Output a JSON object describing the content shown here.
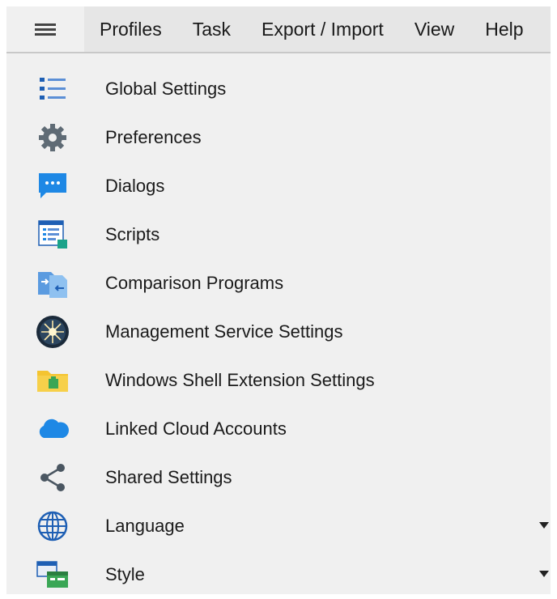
{
  "menubar": {
    "items": [
      "Profiles",
      "Task",
      "Export / Import",
      "View",
      "Help"
    ]
  },
  "list": {
    "items": [
      {
        "label": "Global Settings",
        "icon": "list-icon",
        "submenu": false
      },
      {
        "label": "Preferences",
        "icon": "gear-icon",
        "submenu": false
      },
      {
        "label": "Dialogs",
        "icon": "chat-bubble-icon",
        "submenu": false
      },
      {
        "label": "Scripts",
        "icon": "script-icon",
        "submenu": false
      },
      {
        "label": "Comparison Programs",
        "icon": "compare-files-icon",
        "submenu": false
      },
      {
        "label": "Management Service Settings",
        "icon": "network-globe-icon",
        "submenu": false
      },
      {
        "label": "Windows Shell Extension Settings",
        "icon": "folder-extension-icon",
        "submenu": false
      },
      {
        "label": "Linked Cloud Accounts",
        "icon": "cloud-icon",
        "submenu": false
      },
      {
        "label": "Shared Settings",
        "icon": "share-icon",
        "submenu": false
      },
      {
        "label": "Language",
        "icon": "globe-icon",
        "submenu": true
      },
      {
        "label": "Style",
        "icon": "style-window-icon",
        "submenu": true
      }
    ]
  },
  "colors": {
    "background": "#f0f0f0",
    "accent_blue": "#1e88e5",
    "gear_gray": "#5f6b75",
    "folder_yellow": "#f4c430",
    "green": "#3aa655"
  }
}
